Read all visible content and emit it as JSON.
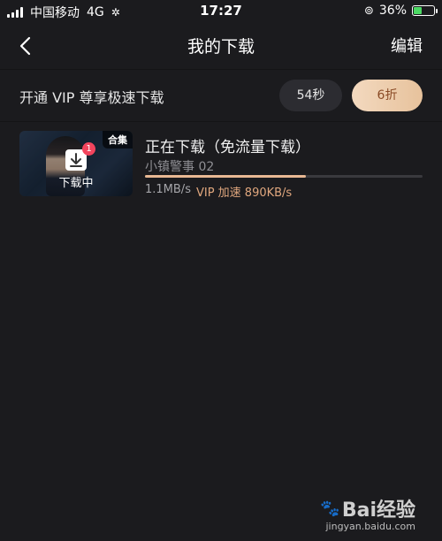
{
  "status_bar": {
    "carrier": "中国移动",
    "network": "4G",
    "time": "17:27",
    "battery": "36%",
    "battery_level": 0.36
  },
  "navbar": {
    "title": "我的下载",
    "edit_label": "编辑"
  },
  "vip_banner": {
    "text": "开通 VIP 尊享极速下载",
    "time_label": "54秒",
    "discount_label": "6折"
  },
  "downloads": [
    {
      "tag": "合集",
      "badge": "1",
      "overlay_label": "下载中",
      "title": "正在下载（免流量下载）",
      "subtitle": "小镇警事 02",
      "progress": 0.58,
      "speed": "1.1MB/s",
      "vip_speed": "VIP 加速 890KB/s"
    }
  ],
  "watermark": {
    "brand": "Bai经验",
    "url": "jingyan.baidu.com"
  },
  "colors": {
    "background": "#1b1b1e",
    "accent_gold": "#e8b893",
    "badge_red": "#f2445d"
  }
}
